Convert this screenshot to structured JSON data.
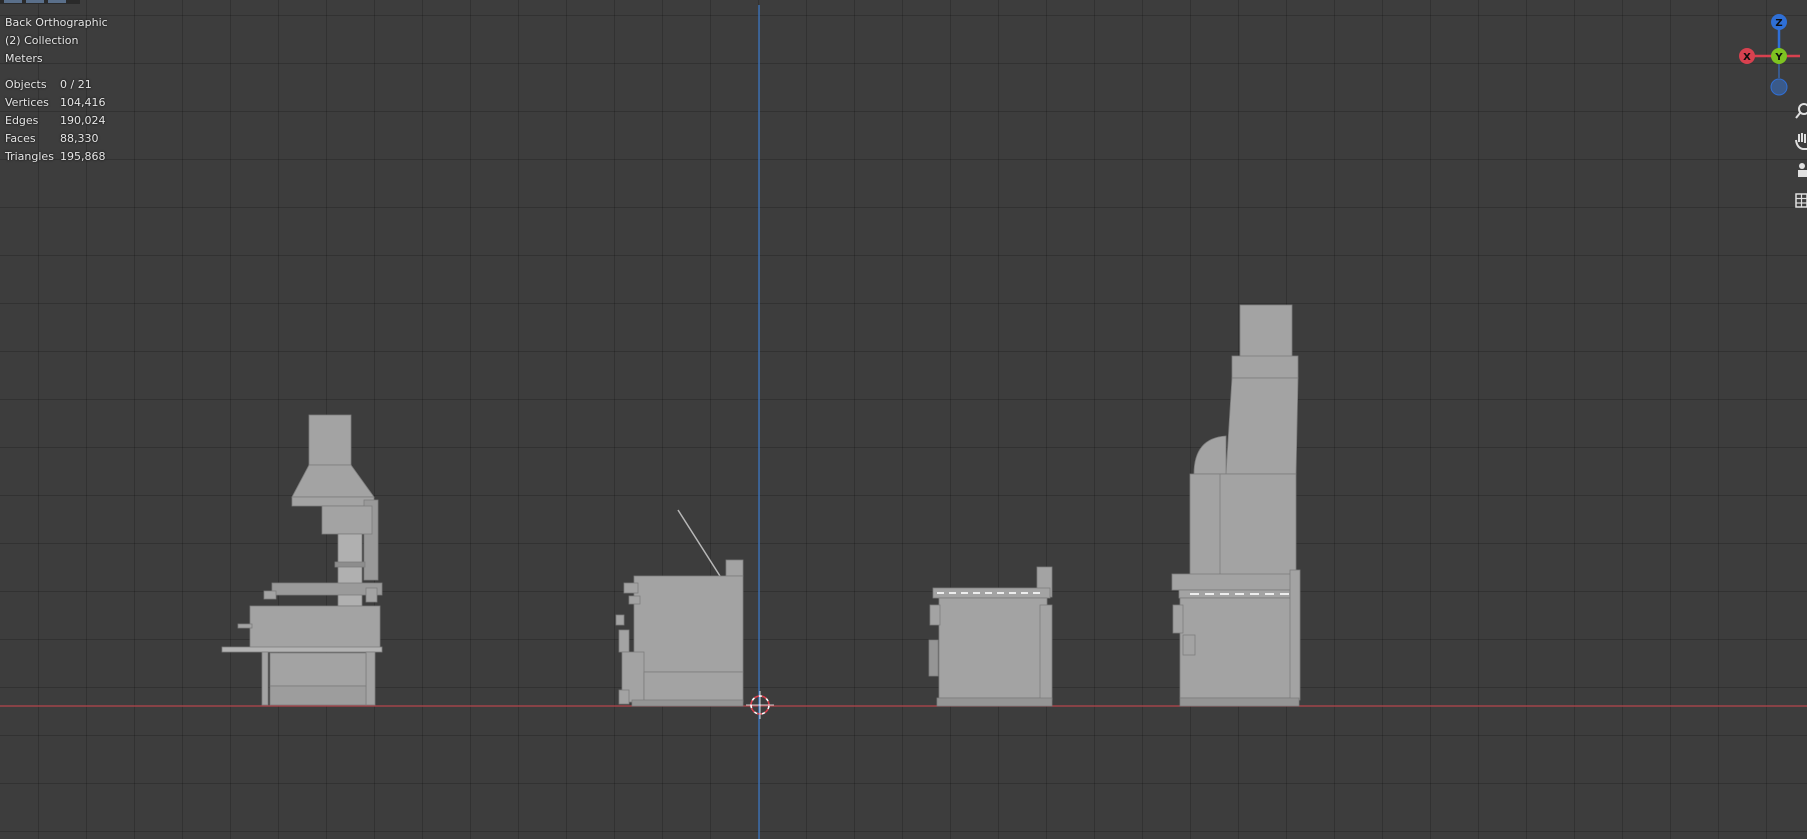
{
  "viewport": {
    "view_name": "Back Orthographic",
    "collection": "(2) Collection",
    "units": "Meters",
    "stats": [
      {
        "label": "Objects",
        "value": "0 / 21"
      },
      {
        "label": "Vertices",
        "value": "104,416"
      },
      {
        "label": "Edges",
        "value": "190,024"
      },
      {
        "label": "Faces",
        "value": "88,330"
      },
      {
        "label": "Triangles",
        "value": "195,868"
      }
    ]
  },
  "gizmo": {
    "z_label": "Z",
    "y_label": "Y",
    "x_label": "X",
    "colors": {
      "z": "#2f6fd6",
      "y": "#7ec321",
      "x": "#d8414f",
      "neg": "#3a5a8a"
    }
  },
  "nav_icons": [
    "zoom-icon",
    "hand-pan-icon",
    "camera-icon",
    "grid-perspective-icon"
  ],
  "colors": {
    "background": "#3d3d3d",
    "x_axis": "#b5454c",
    "z_axis": "#3f7fd0",
    "mesh": "#a3a3a3"
  }
}
